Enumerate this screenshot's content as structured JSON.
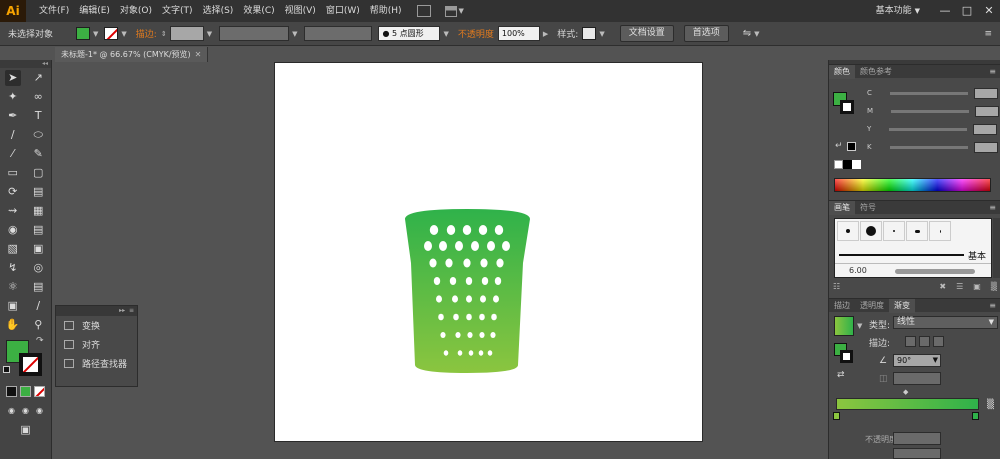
{
  "app": {
    "logo": "Ai",
    "menus": [
      "文件(F)",
      "编辑(E)",
      "对象(O)",
      "文字(T)",
      "选择(S)",
      "效果(C)",
      "视图(V)",
      "窗口(W)",
      "帮助(H)"
    ],
    "workspace": "基本功能",
    "window_controls": [
      "—",
      "□",
      "✕"
    ]
  },
  "control_bar": {
    "selection": "未选择对象",
    "stroke_label": "描边:",
    "brush_value": "5 点圆形",
    "opacity_label": "不透明度",
    "opacity_value": "100%",
    "style_label": "样式:",
    "doc_setup": "文档设置",
    "preferences": "首选项"
  },
  "document": {
    "tab_title": "未标题-1* @ 66.67% (CMYK/预览)",
    "close": "✕"
  },
  "float_panel": {
    "items": [
      "变换",
      "对齐",
      "路径查找器"
    ]
  },
  "color_panel": {
    "tabs": [
      "颜色",
      "颜色参考"
    ],
    "channels": [
      "C",
      "M",
      "Y",
      "K"
    ],
    "unit": "%"
  },
  "brush_panel": {
    "tabs": [
      "画笔",
      "符号"
    ],
    "basic": "基本",
    "size": "6.00"
  },
  "gradient_panel": {
    "tabs": [
      "描边",
      "透明度",
      "渐变"
    ],
    "type_label": "类型:",
    "type_value": "线性",
    "stroke_label": "描边:",
    "angle": "90°",
    "opacity_label": "不透明度"
  },
  "colors": {
    "fill": "#3cb043",
    "gradient_start": "#8bc53f",
    "gradient_end": "#2fb24a",
    "accent": "#e07a1e"
  }
}
